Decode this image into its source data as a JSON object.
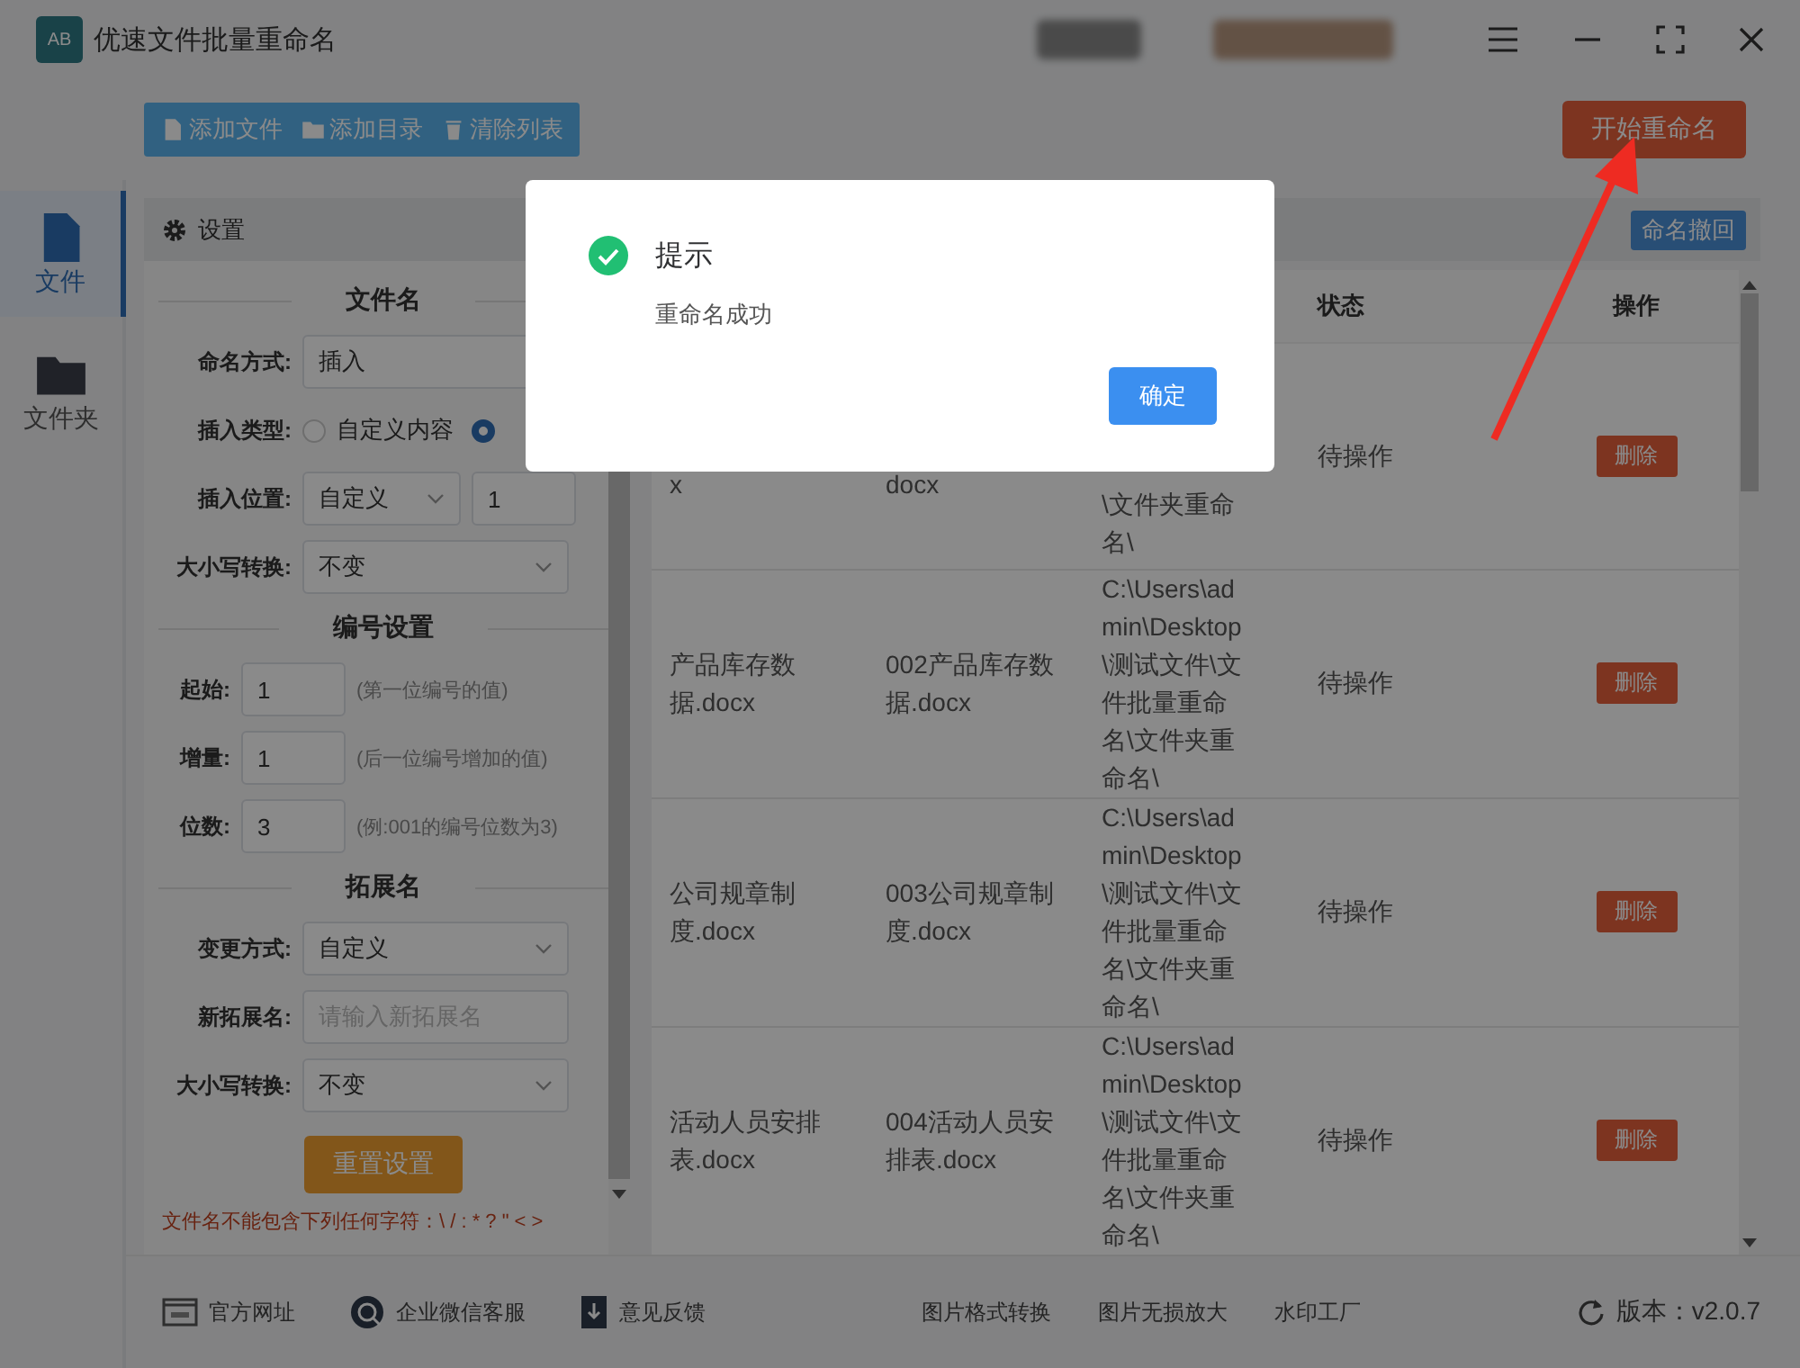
{
  "window": {
    "title": "优速文件批量重命名",
    "logo": "AB"
  },
  "toolbar": {
    "buttons": [
      {
        "label": "添加文件",
        "kind": "file"
      },
      {
        "label": "添加目录",
        "kind": "folder"
      },
      {
        "label": "清除列表",
        "kind": "trash"
      }
    ],
    "start_button": "开始重命名"
  },
  "sidebar": {
    "items": [
      {
        "label": "文件",
        "kind": "file",
        "selected": true
      },
      {
        "label": "文件夹",
        "kind": "folder",
        "selected": false
      }
    ]
  },
  "settings": {
    "title": "设置",
    "sections": [
      {
        "title": "文件名",
        "rows": [
          {
            "kind": "select",
            "label": "命名方式:",
            "value": "插入"
          },
          {
            "kind": "radio",
            "label": "插入类型:",
            "options": [
              {
                "label": "自定义内容",
                "selected": false
              },
              {
                "selected": true
              }
            ]
          },
          {
            "kind": "select_input",
            "label": "插入位置:",
            "value": "自定义",
            "input": "1"
          },
          {
            "kind": "select",
            "label": "大小写转换:",
            "value": "不变"
          }
        ]
      },
      {
        "title": "编号设置",
        "rows": [
          {
            "kind": "number",
            "label": "起始:",
            "value": "1",
            "hint": "(第一位编号的值)"
          },
          {
            "kind": "number",
            "label": "增量:",
            "value": "1",
            "hint": "(后一位编号增加的值)"
          },
          {
            "kind": "number",
            "label": "位数:",
            "value": "3",
            "hint": "(例:001的编号位数为3)"
          }
        ]
      },
      {
        "title": "拓展名",
        "rows": [
          {
            "kind": "select",
            "label": "变更方式:",
            "value": "自定义"
          },
          {
            "kind": "input",
            "label": "新拓展名:",
            "placeholder": "请输入新拓展名"
          },
          {
            "kind": "select",
            "label": "大小写转换:",
            "value": "不变"
          }
        ]
      }
    ],
    "reset_button": "重置设置",
    "warning": "文件名不能包含下列任何字符：\\ / : * ? \" < >"
  },
  "table": {
    "undo_button": "命名撤回",
    "columns": [
      "状态",
      "操作"
    ],
    "rows": [
      {
        "column_1": "x",
        "column_2": "docx",
        "column_3": "\\文件夹重命名\\",
        "status": "待操作",
        "action": "删除"
      },
      {
        "column_1": "产品库存数据.docx",
        "column_2": "002产品库存数据.docx",
        "column_3": "C:\\Users\\admin\\Desktop\\测试文件\\文件批量重命名\\文件夹重命名\\",
        "status": "待操作",
        "action": "删除"
      },
      {
        "column_1": "公司规章制度.docx",
        "column_2": "003公司规章制度.docx",
        "column_3": "C:\\Users\\admin\\Desktop\\测试文件\\文件批量重命名\\文件夹重命名\\",
        "status": "待操作",
        "action": "删除"
      },
      {
        "column_1": "活动人员安排表.docx",
        "column_2": "004活动人员安排表.docx",
        "column_3": "C:\\Users\\admin\\Desktop\\测试文件\\文件批量重命名\\文件夹重命名\\",
        "status": "待操作",
        "action": "删除"
      }
    ]
  },
  "footer": {
    "links": [
      {
        "label": "官方网址",
        "kind": "web"
      },
      {
        "label": "企业微信客服",
        "kind": "chat"
      },
      {
        "label": "意见反馈",
        "kind": "doc"
      },
      {
        "label": "图片格式转换"
      },
      {
        "label": "图片无损放大"
      },
      {
        "label": "水印工厂"
      }
    ],
    "version": "版本：v2.0.7"
  },
  "dialog": {
    "kind": "success",
    "title": "提示",
    "message": "重命名成功",
    "button": "确定"
  }
}
